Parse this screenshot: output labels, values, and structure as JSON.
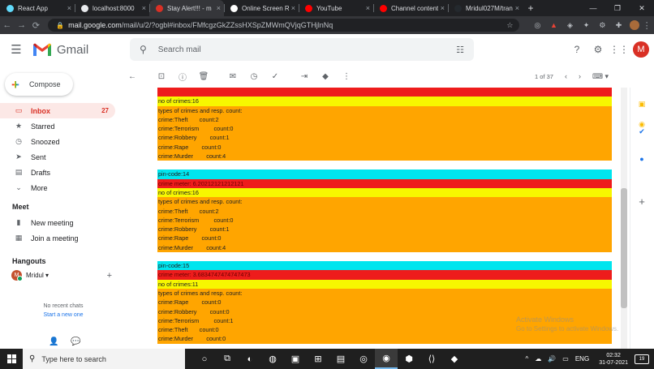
{
  "browser": {
    "tabs": [
      {
        "title": "React App",
        "color": "#61dafb",
        "close": "×"
      },
      {
        "title": "localhost:8000",
        "color": "#e8eaed",
        "close": "×"
      },
      {
        "title": "Stay Alert!!! - m",
        "color": "#d93025",
        "close": "×"
      },
      {
        "title": "Online Screen Re",
        "color": "#ffffff",
        "close": "×"
      },
      {
        "title": "YouTube",
        "color": "#ff0000",
        "close": "×"
      },
      {
        "title": "Channel content",
        "color": "#ff0000",
        "close": "×"
      },
      {
        "title": "Mridul027M/tran",
        "color": "#24292e",
        "close": "×"
      }
    ],
    "new_tab": "+",
    "window_controls": {
      "minimize": "—",
      "restore": "❐",
      "close": "✕"
    },
    "nav": {
      "back": "←",
      "forward": "→",
      "reload": "⟳"
    },
    "url_host": "mail.google.com",
    "url_path": "/mail/u/2/?ogbl#inbox/FMfcgzGkZZssHXSpZMWmQVjqGTHjlnNq",
    "lock_icon": "🔒",
    "bookmark_icon": "☆"
  },
  "gmail": {
    "menu_icon": "☰",
    "logo_text": "Gmail",
    "search": {
      "placeholder": "Search mail",
      "icon": "⚲",
      "filter_icon": "☷"
    },
    "header_icons": {
      "help": "?",
      "settings": "⚙",
      "apps": "⋮⋮"
    },
    "avatar_letter": "M"
  },
  "sidebar": {
    "compose_plus": "+",
    "compose_label": "Compose",
    "items": [
      {
        "label": "Inbox",
        "count": "27",
        "icon": "▭"
      },
      {
        "label": "Starred",
        "count": "",
        "icon": "★"
      },
      {
        "label": "Snoozed",
        "count": "",
        "icon": "◷"
      },
      {
        "label": "Sent",
        "count": "",
        "icon": "➤"
      },
      {
        "label": "Drafts",
        "count": "",
        "icon": "▤"
      },
      {
        "label": "More",
        "count": "",
        "icon": "⌄"
      }
    ],
    "meet_heading": "Meet",
    "meet_items": [
      {
        "label": "New meeting",
        "icon": "▮"
      },
      {
        "label": "Join a meeting",
        "icon": "▦"
      }
    ],
    "hangouts_heading": "Hangouts",
    "hangouts_user": {
      "initial": "M",
      "name": "Mridul ▾",
      "add": "+"
    },
    "no_chats": "No recent chats",
    "start_chat": "Start a new one",
    "footer_icons": {
      "person": "👤",
      "chat": "💬"
    }
  },
  "toolbar": {
    "back": "←",
    "archive": "⊡",
    "spam": "ⓘ",
    "delete": "🗑",
    "mark_unread": "✉",
    "snooze": "◷",
    "add_task": "✓",
    "move": "⇥",
    "label": "◆",
    "more": "⋮",
    "page_count": "1 of 37",
    "prev": "‹",
    "next": "›",
    "keyboard": "⌨ ▾"
  },
  "email": {
    "blocks": [
      {
        "rows": [
          {
            "text": "",
            "color": "red"
          },
          {
            "text": "no of crimes:16",
            "color": "yellow"
          },
          {
            "text": "types of crimes and resp. count:",
            "color": "orange"
          },
          {
            "text": "crime:Theft       count:2",
            "color": "orange"
          },
          {
            "text": "crime:Terrorism         count:0",
            "color": "orange"
          },
          {
            "text": "crime:Robbery        count:1",
            "color": "orange"
          },
          {
            "text": "crime:Rape        count:0",
            "color": "orange"
          },
          {
            "text": "crime:Murder        count:4",
            "color": "orange"
          }
        ]
      },
      {
        "rows": [
          {
            "text": "pin-code:14",
            "color": "cyan"
          },
          {
            "text": "crime meter: 6.20212121212121",
            "color": "red"
          },
          {
            "text": "no of crimes:16",
            "color": "yellow"
          },
          {
            "text": "types of crimes and resp. count:",
            "color": "orange"
          },
          {
            "text": "crime:Theft       count:2",
            "color": "orange"
          },
          {
            "text": "crime:Terrorism         count:0",
            "color": "orange"
          },
          {
            "text": "crime:Robbery        count:1",
            "color": "orange"
          },
          {
            "text": "crime:Rape        count:0",
            "color": "orange"
          },
          {
            "text": "crime:Murder        count:4",
            "color": "orange"
          }
        ]
      },
      {
        "rows": [
          {
            "text": "pin-code:15",
            "color": "cyan"
          },
          {
            "text": "crime meter: 3.6834747474747473",
            "color": "red"
          },
          {
            "text": "no of crimes:11",
            "color": "yellow"
          },
          {
            "text": "types of crimes and resp. count:",
            "color": "orange"
          },
          {
            "text": "crime:Rape        count:0",
            "color": "orange"
          },
          {
            "text": "crime:Robbery        count:0",
            "color": "orange"
          },
          {
            "text": "crime:Terrorism         count:1",
            "color": "orange"
          },
          {
            "text": "crime:Theft       count:0",
            "color": "orange"
          },
          {
            "text": "crime:Murder        count:0",
            "color": "orange"
          }
        ]
      }
    ],
    "watermark_line1": "Activate Windows",
    "watermark_line2": "Go to Settings to activate Windows."
  },
  "side_panel": {
    "calendar": "▣",
    "keep": "◉",
    "tasks": "✔",
    "contacts": "●",
    "add": "+"
  },
  "taskbar": {
    "search_icon": "⚲",
    "search_placeholder": "Type here to search",
    "apps": [
      "○",
      "⧉",
      "◐",
      "◍",
      "▣",
      "⊞",
      "▤",
      "◎",
      "◉",
      "⬢",
      "⟨⟩",
      "◆"
    ],
    "tray_icons": [
      "^",
      "☁",
      "🔊",
      "▭"
    ],
    "lang": "ENG",
    "time": "02:32",
    "date": "31-07-2021",
    "notifications": "19"
  },
  "colors": {
    "cyan": "#00e5ee",
    "red": "#ee1c1c",
    "yellow": "#f7f700",
    "orange": "#ffa500",
    "gmail_red": "#d93025"
  }
}
